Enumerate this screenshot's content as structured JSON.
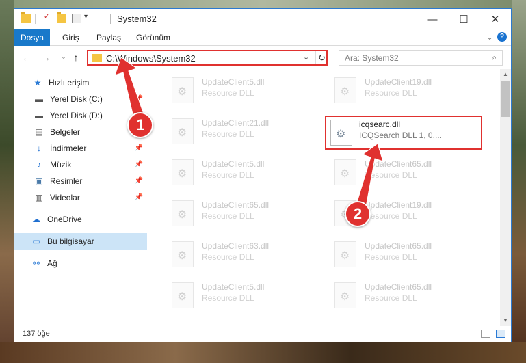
{
  "window": {
    "title": "System32",
    "min_glyph": "—",
    "max_glyph": "☐",
    "close_glyph": "✕"
  },
  "ribbon": {
    "tabs": [
      "Dosya",
      "Giriş",
      "Paylaş",
      "Görünüm"
    ],
    "expand_glyph": "⌄",
    "help_glyph": "?"
  },
  "nav": {
    "back_glyph": "←",
    "forward_glyph": "→",
    "recent_glyph": "⌄",
    "up_glyph": "↑"
  },
  "address": {
    "path": "C:\\Windows\\System32",
    "dropdown_glyph": "⌄",
    "refresh_glyph": "↻"
  },
  "search": {
    "placeholder": "Ara: System32",
    "icon_glyph": "⌕"
  },
  "sidebar": {
    "items": [
      {
        "label": "Hızlı erişim",
        "icon": "star-icon",
        "glyph": "★"
      },
      {
        "label": "Yerel Disk (C:)",
        "icon": "drive-icon",
        "glyph": "▬"
      },
      {
        "label": "Yerel Disk (D:)",
        "icon": "drive-icon",
        "glyph": "▬"
      },
      {
        "label": "Belgeler",
        "icon": "documents-icon",
        "glyph": "▤"
      },
      {
        "label": "İndirmeler",
        "icon": "downloads-icon",
        "glyph": "↓"
      },
      {
        "label": "Müzik",
        "icon": "music-icon",
        "glyph": "♪"
      },
      {
        "label": "Resimler",
        "icon": "pictures-icon",
        "glyph": "▣"
      },
      {
        "label": "Videolar",
        "icon": "videos-icon",
        "glyph": "▥"
      },
      {
        "label": "OneDrive",
        "icon": "cloud-icon",
        "glyph": "☁"
      },
      {
        "label": "Bu bilgisayar",
        "icon": "computer-icon",
        "glyph": "▭"
      },
      {
        "label": "Ağ",
        "icon": "network-icon",
        "glyph": "⚯"
      }
    ],
    "pin_glyph": "📌"
  },
  "files": [
    {
      "name": "UpdateClient5.dll",
      "type": "Resource DLL"
    },
    {
      "name": "UpdateClient19.dll",
      "type": "Resource DLL"
    },
    {
      "name": "UpdateClient21.dll",
      "type": "Resource DLL"
    },
    {
      "name": "icqsearc.dll",
      "type": "ICQSearch DLL 1, 0,..."
    },
    {
      "name": "UpdateClient5.dll",
      "type": "Resource DLL"
    },
    {
      "name": "UpdateClient65.dll",
      "type": "Resource DLL"
    },
    {
      "name": "UpdateClient65.dll",
      "type": "Resource DLL"
    },
    {
      "name": "UpdateClient19.dll",
      "type": "Resource DLL"
    },
    {
      "name": "UpdateClient63.dll",
      "type": "Resource DLL"
    },
    {
      "name": "UpdateClient65.dll",
      "type": "Resource DLL"
    },
    {
      "name": "UpdateClient5.dll",
      "type": "Resource DLL"
    },
    {
      "name": "UpdateClient65.dll",
      "type": "Resource DLL"
    }
  ],
  "status": {
    "item_count": "137 öğe"
  },
  "annotations": {
    "step1": "1",
    "step2": "2",
    "color": "#e0312f"
  },
  "scrollbar": {
    "up_glyph": "▲",
    "down_glyph": "▼"
  }
}
